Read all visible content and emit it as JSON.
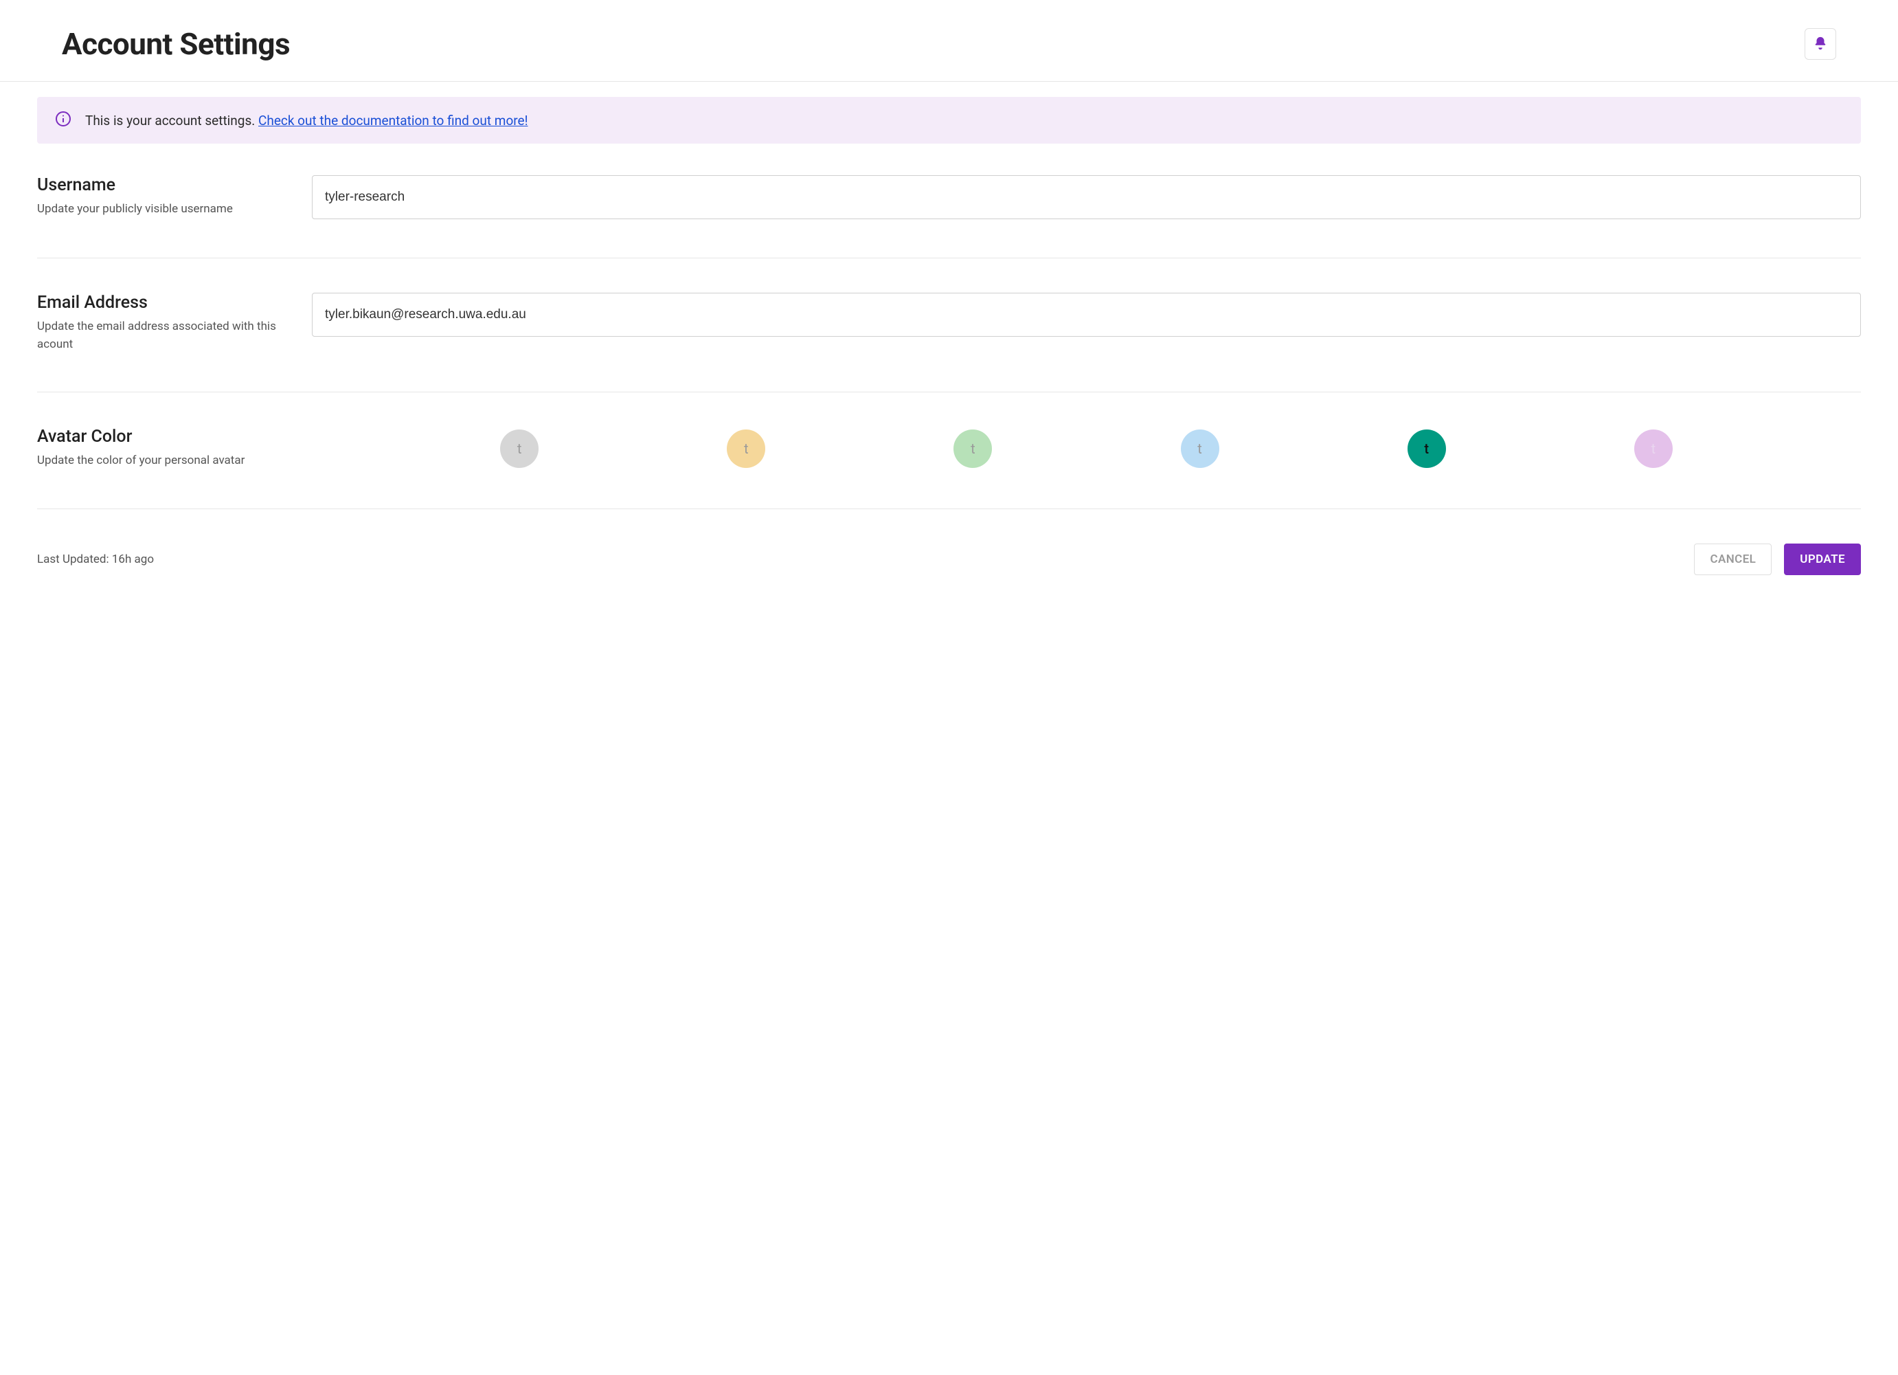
{
  "header": {
    "title": "Account Settings",
    "bell_icon": "bell-icon"
  },
  "banner": {
    "info_icon": "info-circle-icon",
    "text": "This is your account settings. ",
    "link_text": "Check out the documentation to find out more!"
  },
  "sections": {
    "username": {
      "label": "Username",
      "helper": "Update your publicly visible username",
      "value": "tyler-research"
    },
    "email": {
      "label": "Email Address",
      "helper": "Update the email address associated with this acount",
      "value": "tyler.bikaun@research.uwa.edu.au"
    },
    "avatar": {
      "label": "Avatar Color",
      "helper": "Update the color of your personal avatar",
      "glyph": "t",
      "selected_index": 4,
      "options": [
        {
          "bg": "#d6d6d6",
          "text_class": "muted"
        },
        {
          "bg": "#f5d79a",
          "text_class": "muted"
        },
        {
          "bg": "#b7e1b8",
          "text_class": "muted"
        },
        {
          "bg": "#b9dcf5",
          "text_class": "muted"
        },
        {
          "bg": "#009a82",
          "text_class": "selected"
        },
        {
          "bg": "#e4c1ea",
          "text_class": "pinkish"
        }
      ]
    }
  },
  "footer": {
    "last_updated_label": "Last Updated: 16h ago",
    "cancel_label": "CANCEL",
    "update_label": "UPDATE"
  },
  "colors": {
    "accent": "#7b2cbf",
    "link": "#1a4fd6",
    "banner_bg": "#f4ebf9"
  }
}
